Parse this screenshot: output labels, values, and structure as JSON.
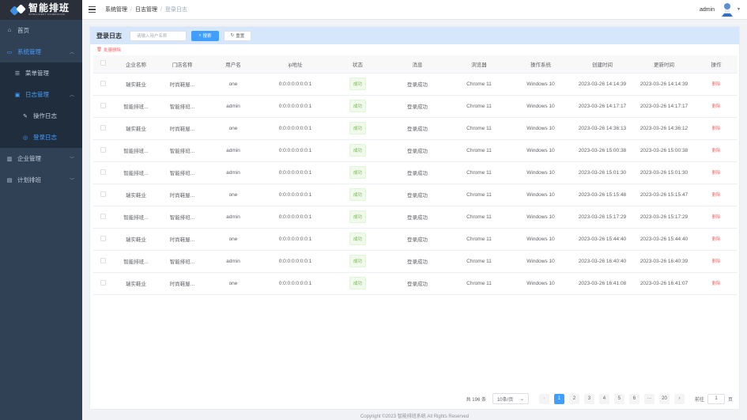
{
  "logo": {
    "title": "智能排班",
    "subtitle": "INTELLIGENT SCHEDULING"
  },
  "sidebar": {
    "items": [
      {
        "label": "首页",
        "icon": "home-icon"
      },
      {
        "label": "系统管理",
        "icon": "monitor-icon"
      },
      {
        "label": "菜单管理",
        "icon": "tree-table-icon"
      },
      {
        "label": "日志管理",
        "icon": "log-icon"
      },
      {
        "label": "操作日志",
        "icon": "form-icon"
      },
      {
        "label": "登录日志",
        "icon": "logininfor-icon"
      },
      {
        "label": "企业管理",
        "icon": "building-icon"
      },
      {
        "label": "计划排班",
        "icon": "calendar-icon"
      }
    ]
  },
  "header": {
    "breadcrumb": [
      "系统管理",
      "日志管理",
      "登录日志"
    ],
    "username": "admin"
  },
  "search": {
    "title": "登录日志",
    "placeholder": "请输入用户名称",
    "search_label": "搜索",
    "reset_label": "重置",
    "batch_delete_label": "批量删除"
  },
  "table": {
    "columns": [
      "企业名称",
      "门店名称",
      "用户名",
      "ip地址",
      "状态",
      "消息",
      "浏览器",
      "操作系统",
      "创建时间",
      "更新时间",
      "操作"
    ],
    "rows": [
      [
        "瑞实鞋业",
        "时尚鞋屋...",
        "one",
        "0:0:0:0:0:0:0:1",
        "成功",
        "登录成功",
        "Chrome 11",
        "Windows 10",
        "2023-03-26 14:14:39",
        "2023-03-26 14:14:39",
        "删除"
      ],
      [
        "智能排班...",
        "智能排班...",
        "admin",
        "0:0:0:0:0:0:0:1",
        "成功",
        "登录成功",
        "Chrome 11",
        "Windows 10",
        "2023-03-26 14:17:17",
        "2023-03-26 14:17:17",
        "删除"
      ],
      [
        "瑞实鞋业",
        "时尚鞋屋...",
        "one",
        "0:0:0:0:0:0:0:1",
        "成功",
        "登录成功",
        "Chrome 11",
        "Windows 10",
        "2023-03-26 14:36:13",
        "2023-03-26 14:36:12",
        "删除"
      ],
      [
        "智能排班...",
        "智能排班...",
        "admin",
        "0:0:0:0:0:0:0:1",
        "成功",
        "登录成功",
        "Chrome 11",
        "Windows 10",
        "2023-03-26 15:00:38",
        "2023-03-26 15:00:38",
        "删除"
      ],
      [
        "智能排班...",
        "智能排班...",
        "admin",
        "0:0:0:0:0:0:0:1",
        "成功",
        "登录成功",
        "Chrome 11",
        "Windows 10",
        "2023-03-26 15:01:30",
        "2023-03-26 15:01:30",
        "删除"
      ],
      [
        "瑞实鞋业",
        "时尚鞋屋...",
        "one",
        "0:0:0:0:0:0:0:1",
        "成功",
        "登录成功",
        "Chrome 11",
        "Windows 10",
        "2023-03-26 15:15:48",
        "2023-03-26 15:15:47",
        "删除"
      ],
      [
        "智能排班...",
        "智能排班...",
        "admin",
        "0:0:0:0:0:0:0:1",
        "成功",
        "登录成功",
        "Chrome 11",
        "Windows 10",
        "2023-03-26 15:17:29",
        "2023-03-26 15:17:29",
        "删除"
      ],
      [
        "瑞实鞋业",
        "时尚鞋屋...",
        "one",
        "0:0:0:0:0:0:0:1",
        "成功",
        "登录成功",
        "Chrome 11",
        "Windows 10",
        "2023-03-26 15:44:40",
        "2023-03-26 15:44:40",
        "删除"
      ],
      [
        "智能排班...",
        "智能排班...",
        "admin",
        "0:0:0:0:0:0:0:1",
        "成功",
        "登录成功",
        "Chrome 11",
        "Windows 10",
        "2023-03-26 16:40:40",
        "2023-03-26 16:40:39",
        "删除"
      ],
      [
        "瑞实鞋业",
        "时尚鞋屋...",
        "one",
        "0:0:0:0:0:0:0:1",
        "成功",
        "登录成功",
        "Chrome 11",
        "Windows 10",
        "2023-03-26 16:41:08",
        "2023-03-26 16:41:07",
        "删除"
      ]
    ]
  },
  "pagination": {
    "total_label": "共 196 条",
    "page_size": "10条/页",
    "pages": [
      "1",
      "2",
      "3",
      "4",
      "5",
      "6",
      "···",
      "20"
    ],
    "current_page": "1",
    "goto_label": "前往",
    "goto_value": "1",
    "page_unit": "页"
  },
  "footer": {
    "text": "Copyright ©2023 智能排班系统 All Rights Reserved"
  },
  "colors": {
    "primary": "#409eff",
    "sidebar_bg": "#304156",
    "success": "#67c23a",
    "danger": "#f56c6c"
  }
}
